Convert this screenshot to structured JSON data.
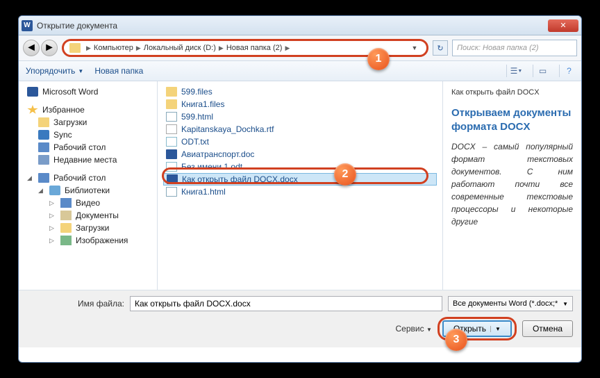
{
  "title": "Открытие документа",
  "close_label": "✕",
  "breadcrumbs": [
    "Компьютер",
    "Локальный диск (D:)",
    "Новая папка (2)"
  ],
  "search_placeholder": "Поиск: Новая папка (2)",
  "toolbar": {
    "organize": "Упорядочить",
    "newfolder": "Новая папка"
  },
  "sidebar": {
    "word": "Microsoft Word",
    "fav": "Избранное",
    "downloads": "Загрузки",
    "sync": "Sync",
    "desktop": "Рабочий стол",
    "recent": "Недавние места",
    "desktop2": "Рабочий стол",
    "libraries": "Библиотеки",
    "video": "Видео",
    "documents": "Документы",
    "downloads2": "Загрузки",
    "images": "Изображения"
  },
  "files": {
    "f0": "599.files",
    "f1": "Книга1.files",
    "f2": "599.html",
    "f3": "Kapitanskaya_Dochka.rtf",
    "f4": "ODT.txt",
    "f5": "Авиатранспорт.doc",
    "f6": "Без имени 1.odt",
    "f7": "Как открыть файл DOCX.docx",
    "f8": "Книга1.html"
  },
  "preview": {
    "title": "Как открыть файл DOCX",
    "heading": "Открываем документы формата DOCX",
    "body": "DOCX – самый популярный формат текстовых документов. С ним работают почти все современные текстовые процессоры и некоторые другие"
  },
  "bottom": {
    "fname_label": "Имя файла:",
    "fname_value": "Как открыть файл DOCX.docx",
    "filter": "Все документы Word (*.docx;*",
    "service": "Сервис",
    "open": "Открыть",
    "cancel": "Отмена"
  },
  "annotations": {
    "a1": "1",
    "a2": "2",
    "a3": "3"
  }
}
